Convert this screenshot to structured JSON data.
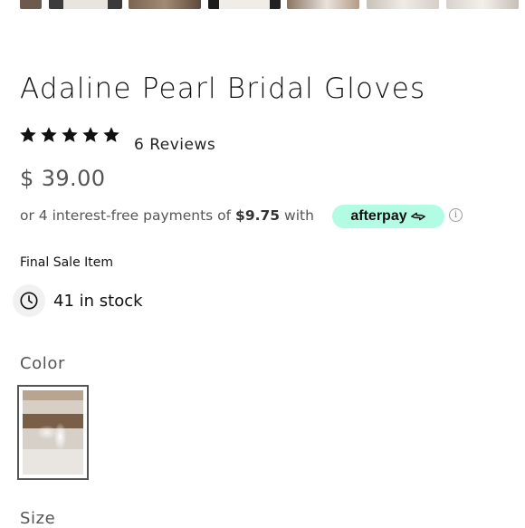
{
  "product": {
    "title": "Adaline Pearl Bridal Gloves",
    "rating_stars": 5,
    "reviews_label": "6 Reviews",
    "price": "$ 39.00",
    "final_sale": "Final Sale Item",
    "stock": "41 in stock"
  },
  "installments": {
    "prefix": "or 4 interest-free payments of",
    "amount": "$9.75",
    "suffix": "with",
    "provider": "afterpay",
    "badge_color": "#b2fce4"
  },
  "options": {
    "color_label": "Color",
    "size_label": "Size"
  },
  "icons": {
    "star": "star-icon",
    "info": "info-icon",
    "clock": "clock-icon",
    "afterpay": "afterpay-logo-icon"
  },
  "info_glyph": "i"
}
